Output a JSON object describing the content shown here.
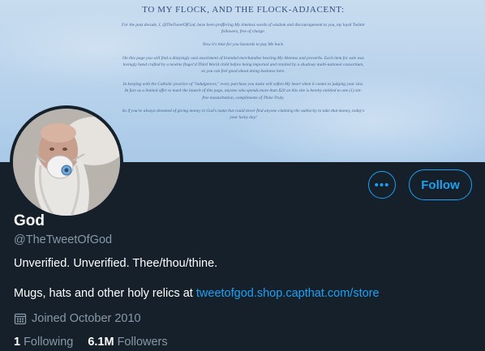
{
  "banner": {
    "heading": "TO MY FLOCK, AND THE FLOCK-ADJACENT:",
    "paragraphs": [
      "For the past decade, I, @TheTweetOfGod, have been proffering My timeless words of wisdom and discouragement to you, my loyal Twitter followers, free of charge.",
      "Now it's time for you bastards to pay Me back.",
      "On this page you will find a dizzyingly vast assortment of branded merchandise bearing My likeness and proverbs. Each item for sale was lovingly hand crafted by a newbie finger'd Third World child before being imported and retailed by a shadowy multi-national consortium, so you can feel good about doing business here.",
      "In keeping with the Catholic practice of \"indulgences,\" every purchase you make will soften My heart when it comes to judging your sins. In fact as a limited offer to mark the launch of this page, anyone who spends more than $20 on this site is hereby entitled to one (1) sin-free masturbation, compliments of Thine Truly.",
      "So if you've always dreamed of giving money in God's name but could never find anyone claiming the authority to take that money, today's your lucky day!"
    ]
  },
  "profile": {
    "name": "God",
    "handle": "@TheTweetOfGod",
    "bio_line1": "Unverified. Unverified. Thee/thou/thine.",
    "bio_line2_text": "Mugs, hats and other holy relics at ",
    "bio_line2_link": "tweetofgod.shop.capthat.com/store",
    "joined": "Joined October 2010",
    "following_count": "1",
    "following_label": "Following",
    "followers_count": "6.1M",
    "followers_label": "Followers"
  },
  "actions": {
    "more_label": "•••",
    "follow_label": "Follow"
  },
  "colors": {
    "background": "#15202b",
    "accent": "#1da1f2",
    "secondary_text": "#8899a6"
  },
  "icons": {
    "more": "more-icon",
    "calendar": "calendar-icon"
  }
}
